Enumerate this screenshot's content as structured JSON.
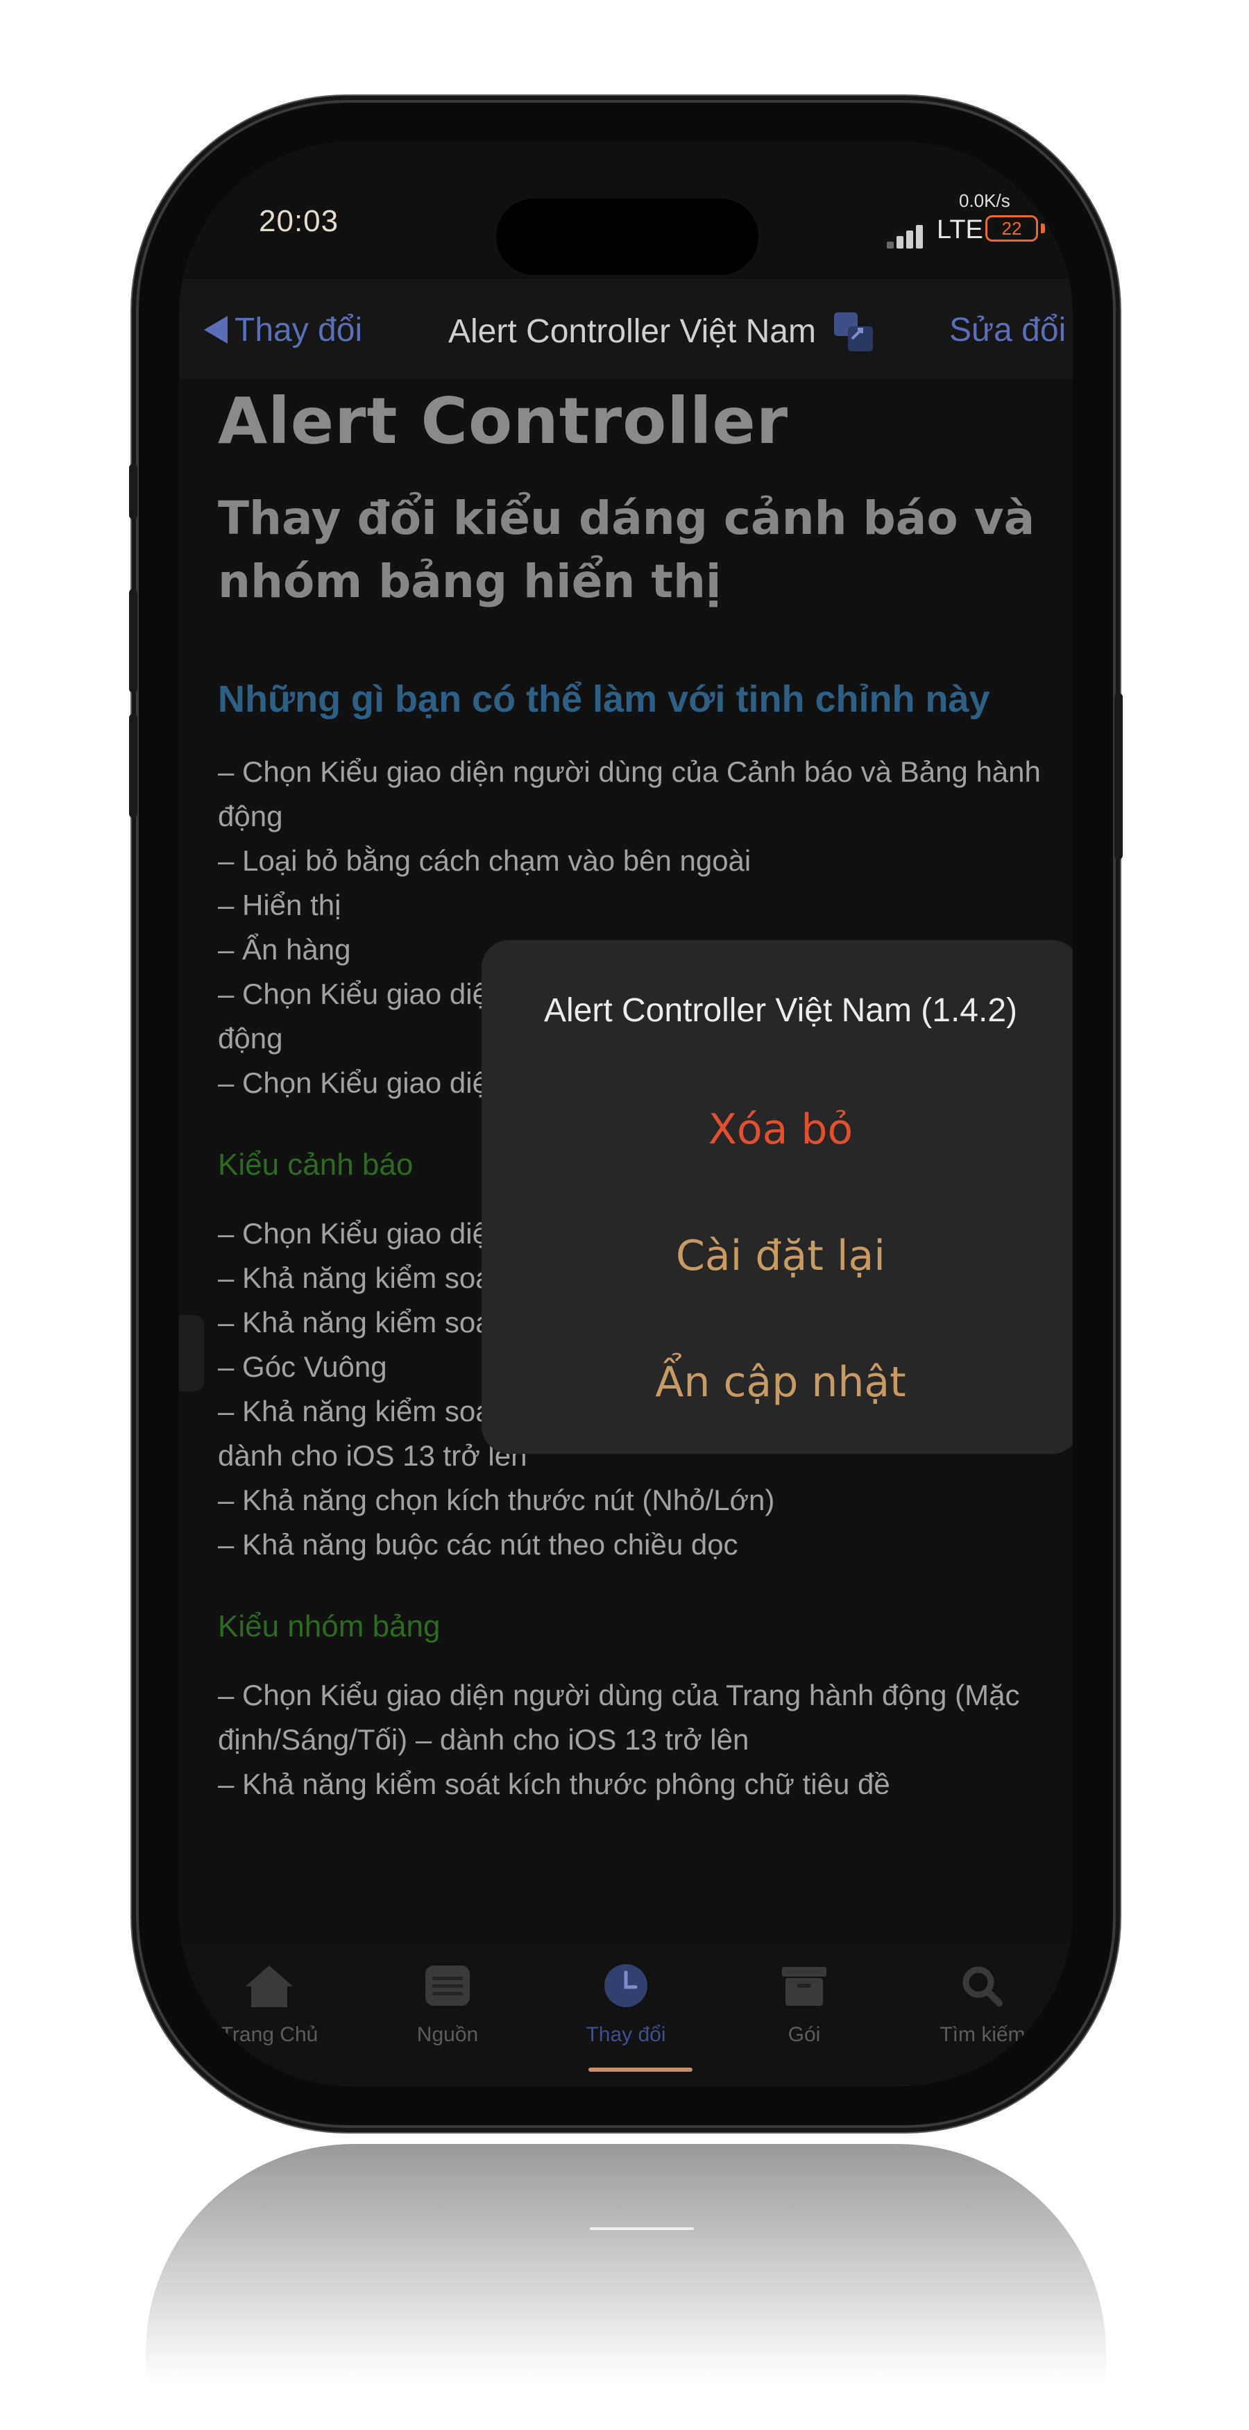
{
  "status_bar": {
    "time": "20:03",
    "net_speed": "0.0K/s",
    "network": "LTE",
    "battery": "22"
  },
  "navbar": {
    "back_label": "Thay đổi",
    "title": "Alert Controller Việt Nam",
    "edit_label": "Sửa đổi"
  },
  "content": {
    "title": "Alert Controller",
    "subtitle": "Thay đổi kiểu dáng cảnh báo và nhóm bảng hiển thị",
    "section_1_heading": "Những gì bạn có thể làm với tinh chỉnh này",
    "section_1_items": [
      "– Chọn Kiểu giao diện người dùng của Cảnh báo và Bảng hành động",
      "– Loại bỏ bằng cách chạm vào bên ngoài",
      "– Hiển thị",
      "– Ẩn hàng",
      "– Chọn Kiểu giao diện người dùng của Cảnh báo và Bảng hành động",
      "– Chọn Kiểu giao diện người dùng để sử dụng kiểu Cảnh báo"
    ],
    "section_2_heading": "Kiểu cảnh báo",
    "section_2_items": [
      "– Chọn Kiểu giao diện người dùng (Mặc định/Sáng/Tối)",
      "– Khả năng kiểm soát kích thước phông chữ tiêu đề",
      "– Khả năng kiểm soát cỡ chữ tin nhắn",
      "– Góc Vuông",
      "– Khả năng kiểm soát mức độ hiển thị của dấu phân cách – dành cho iOS 13 trở lên",
      "– Khả năng chọn kích thước nút (Nhỏ/Lớn)",
      "– Khả năng buộc các nút theo chiều dọc"
    ],
    "section_3_heading": "Kiểu nhóm bảng",
    "section_3_items": [
      "– Chọn Kiểu giao diện người dùng của Trang hành động (Mặc định/Sáng/Tối) – dành cho iOS 13 trở lên",
      "– Khả năng kiểm soát kích thước phông chữ tiêu đề"
    ]
  },
  "alert": {
    "title": "Alert Controller Việt Nam (1.4.2)",
    "destructive_label": "Xóa bỏ",
    "reset_label": "Cài đặt lại",
    "hide_label": "Ẩn cập nhật"
  },
  "tabbar": {
    "tabs": [
      {
        "label": "Trang Chủ",
        "icon": "house-icon"
      },
      {
        "label": "Nguồn",
        "icon": "sources-icon"
      },
      {
        "label": "Thay đổi",
        "icon": "clock-icon"
      },
      {
        "label": "Gói",
        "icon": "box-icon"
      },
      {
        "label": "Tìm kiếm",
        "icon": "search-icon"
      }
    ],
    "active_index": 2
  },
  "colors": {
    "link": "#5a6fb8",
    "destructive": "#e2502f",
    "alert_action": "#c79b63",
    "section_blue": "#2e5f85",
    "section_green": "#2d6b22",
    "battery": "#e86a2e"
  }
}
